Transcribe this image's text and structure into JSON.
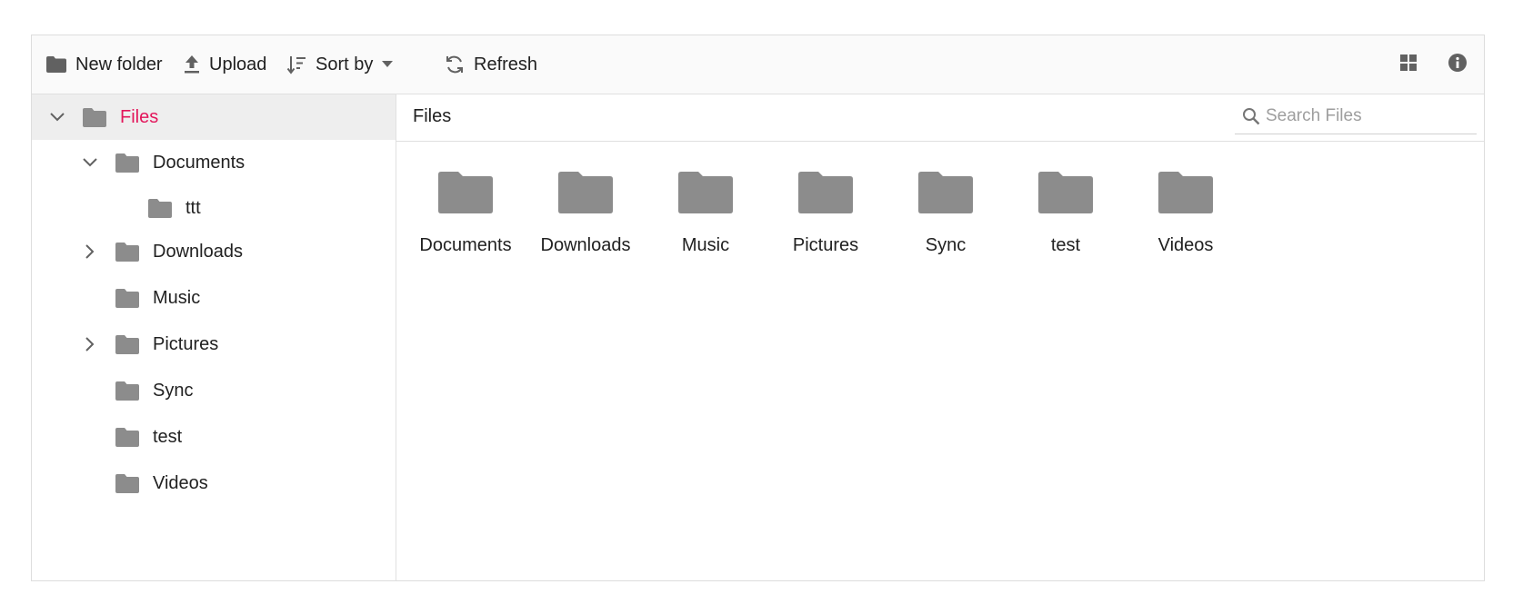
{
  "toolbar": {
    "new_folder_label": "New folder",
    "upload_label": "Upload",
    "sort_by_label": "Sort by",
    "refresh_label": "Refresh"
  },
  "navigation": {
    "items": [
      {
        "label": "Files",
        "icon": "folder-icon",
        "toggle": "chevron-down-icon",
        "selected": true
      },
      {
        "label": "Documents",
        "icon": "folder-icon",
        "toggle": "chevron-down-icon"
      },
      {
        "label": "ttt",
        "icon": "folder-icon",
        "toggle": ""
      },
      {
        "label": "Downloads",
        "icon": "folder-icon",
        "toggle": "chevron-right-icon"
      },
      {
        "label": "Music",
        "icon": "folder-icon",
        "toggle": ""
      },
      {
        "label": "Pictures",
        "icon": "folder-icon",
        "toggle": "chevron-right-icon"
      },
      {
        "label": "Sync",
        "icon": "folder-icon",
        "toggle": ""
      },
      {
        "label": "test",
        "icon": "folder-icon",
        "toggle": ""
      },
      {
        "label": "Videos",
        "icon": "folder-icon",
        "toggle": ""
      }
    ]
  },
  "content": {
    "breadcrumb": "Files",
    "search_placeholder": "Search Files",
    "items": [
      {
        "label": "Documents",
        "icon": "folder-icon"
      },
      {
        "label": "Downloads",
        "icon": "folder-icon"
      },
      {
        "label": "Music",
        "icon": "folder-icon"
      },
      {
        "label": "Pictures",
        "icon": "folder-icon"
      },
      {
        "label": "Sync",
        "icon": "folder-icon"
      },
      {
        "label": "test",
        "icon": "folder-icon"
      },
      {
        "label": "Videos",
        "icon": "folder-icon"
      }
    ]
  },
  "colors": {
    "accent": "#e3165b",
    "icon_gray": "#8c8c8c",
    "toolbar_bg": "#fafafa",
    "selected_bg": "#eeeeee",
    "border": "#e0e0e0"
  }
}
